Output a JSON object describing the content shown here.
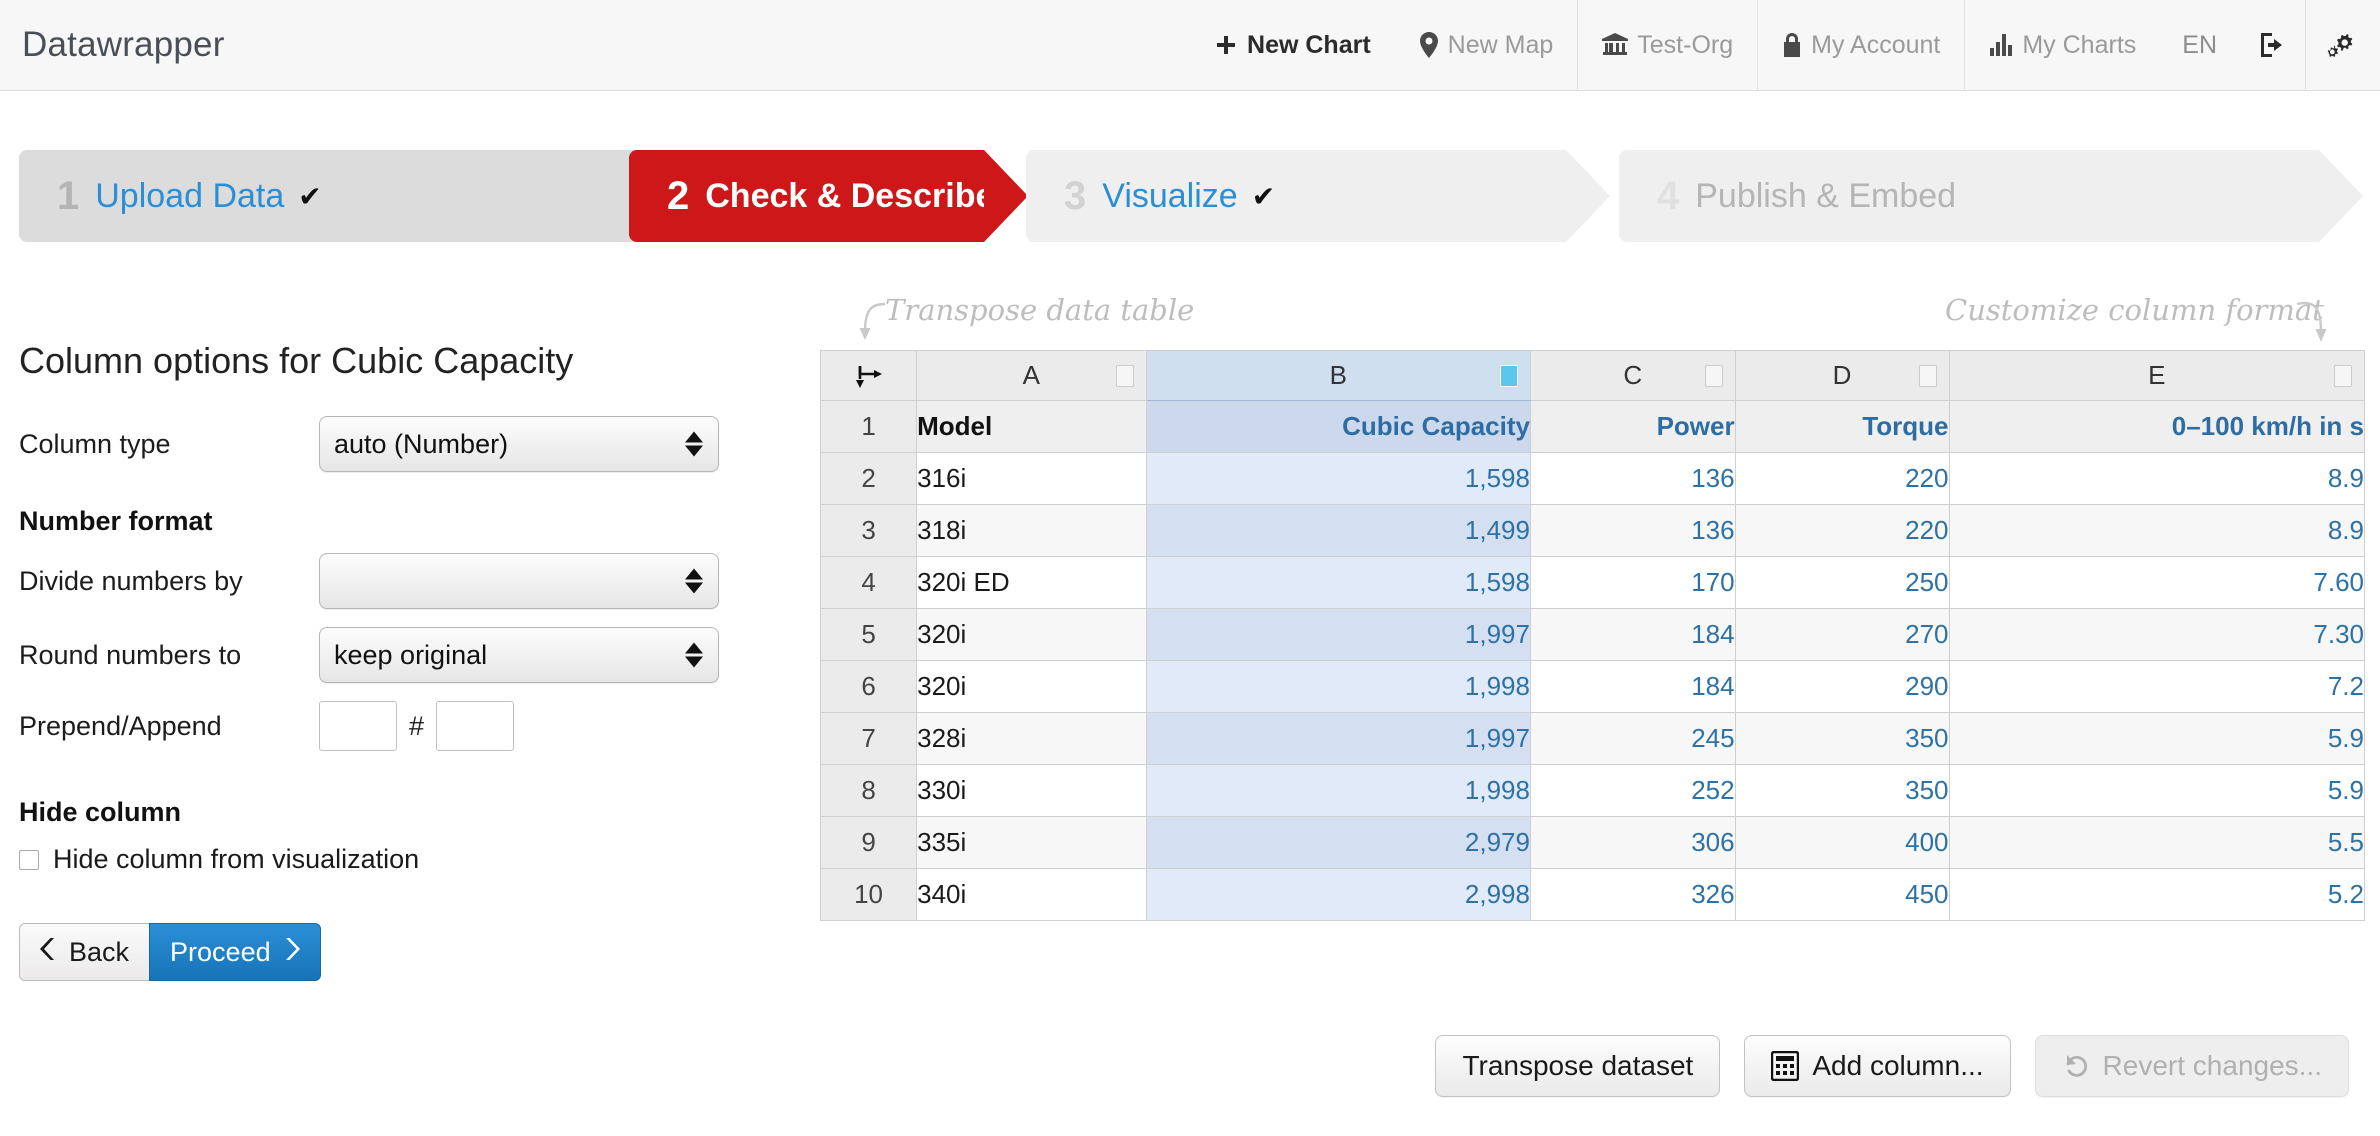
{
  "header": {
    "brand": "Datawrapper",
    "nav": [
      {
        "label": "New Chart",
        "icon": "plus-icon"
      },
      {
        "label": "New Map",
        "icon": "map-pin-icon"
      },
      {
        "label": "Test-Org",
        "icon": "bank-icon"
      },
      {
        "label": "My Account",
        "icon": "lock-icon"
      },
      {
        "label": "My Charts",
        "icon": "bar-chart-icon"
      }
    ],
    "language": "EN",
    "logout_icon": "logout-icon",
    "settings_icon": "gears-icon"
  },
  "steps": [
    {
      "num": "1",
      "label": "Upload Data",
      "check": "✔",
      "state": "done"
    },
    {
      "num": "2",
      "label": "Check & Describe",
      "check": "",
      "state": "active"
    },
    {
      "num": "3",
      "label": "Visualize",
      "check": "✔",
      "state": "light"
    },
    {
      "num": "4",
      "label": "Publish & Embed",
      "check": "",
      "state": "disabled"
    }
  ],
  "panel": {
    "title": "Column options for Cubic Capacity",
    "column_type_label": "Column type",
    "column_type_value": "auto (Number)",
    "number_format_heading": "Number format",
    "divide_label": "Divide numbers by",
    "divide_value": "",
    "round_label": "Round numbers to",
    "round_value": "keep original",
    "prepend_append_label": "Prepend/Append",
    "prepend_value": "",
    "append_value": "",
    "hash_separator": "#",
    "hide_column_heading": "Hide column",
    "hide_column_checkbox_label": "Hide column from visualization",
    "back_button": "Back",
    "proceed_button": "Proceed"
  },
  "annotations": {
    "transpose": "Transpose data table",
    "customize": "Customize column format"
  },
  "bottom_buttons": {
    "transpose_dataset": "Transpose dataset",
    "add_column": "Add column...",
    "revert_changes": "Revert changes..."
  },
  "colors": {
    "brand_red": "#cd1719",
    "link_blue": "#2b8fd6",
    "cell_blue": "#2e72a5",
    "selected_column": "#cfdff0",
    "active_column_icon": "#5bc7ee"
  },
  "chart_data": {
    "type": "table",
    "title": "Column options for Cubic Capacity",
    "column_letters": [
      "A",
      "B",
      "C",
      "D",
      "E"
    ],
    "selected_column": "B",
    "row_numbers": [
      "1",
      "2",
      "3",
      "4",
      "5",
      "6",
      "7",
      "8",
      "9",
      "10"
    ],
    "headers": [
      "Model",
      "Cubic Capacity",
      "Power",
      "Torque",
      "0–100 km/h in s"
    ],
    "rows": [
      [
        "316i",
        "1,598",
        "136",
        "220",
        "8.9"
      ],
      [
        "318i",
        "1,499",
        "136",
        "220",
        "8.9"
      ],
      [
        "320i ED",
        "1,598",
        "170",
        "250",
        "7.60"
      ],
      [
        "320i",
        "1,997",
        "184",
        "270",
        "7.30"
      ],
      [
        "320i",
        "1,998",
        "184",
        "290",
        "7.2"
      ],
      [
        "328i",
        "1,997",
        "245",
        "350",
        "5.9"
      ],
      [
        "330i",
        "1,998",
        "252",
        "350",
        "5.9"
      ],
      [
        "335i",
        "2,979",
        "306",
        "400",
        "5.5"
      ],
      [
        "340i",
        "2,998",
        "326",
        "450",
        "5.2"
      ]
    ]
  }
}
